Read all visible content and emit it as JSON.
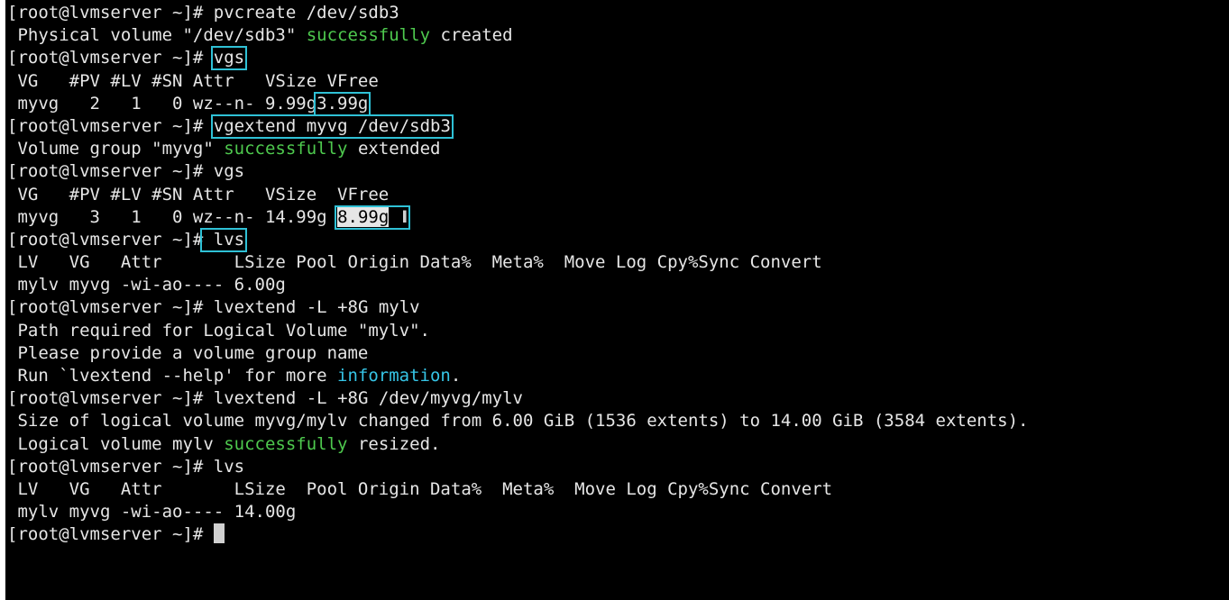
{
  "terminal": {
    "prompt": "[root@lvmserver ~]#",
    "lines": {
      "l0_cmd": "pvcreate /dev/sdb3",
      "l1_a": " Physical volume \"/dev/sdb3\" ",
      "l1_ok": "successfully",
      "l1_b": " created",
      "l2_cmd": "vgs",
      "l3": " VG   #PV #LV #SN Attr   VSize VFree",
      "l4_a": " myvg   2   1   0 wz--n- 9.99g",
      "l4_hl": "3.99g",
      "l5_cmd": "vgextend myvg /dev/sdb3",
      "l6_a": " Volume group \"myvg\" ",
      "l6_ok": "successfully",
      "l6_b": " extended",
      "l7_cmd": "vgs",
      "l8": " VG   #PV #LV #SN Attr   VSize  VFree",
      "l9_a": " myvg   3   1   0 wz--n- 14.99g",
      "l9_hl": "8.99g",
      "l10_cmd": "lvs",
      "l11": " LV   VG   Attr       LSize Pool Origin Data%  Meta%  Move Log Cpy%Sync Convert",
      "l12": " mylv myvg -wi-ao---- 6.00g",
      "l13_cmd": "lvextend -L +8G mylv",
      "l14": " Path required for Logical Volume \"mylv\".",
      "l15": " Please provide a volume group name",
      "l16_a": " Run `lvextend --help' for more ",
      "l16_info": "information",
      "l16_b": ".",
      "l17_cmd": "lvextend -L +8G /dev/myvg/mylv",
      "l18": " Size of logical volume myvg/mylv changed from 6.00 GiB (1536 extents) to 14.00 GiB (3584 extents).",
      "l19_a": " Logical volume mylv ",
      "l19_ok": "successfully",
      "l19_b": " resized.",
      "l20_cmd": "lvs",
      "l21": " LV   VG   Attr       LSize  Pool Origin Data%  Meta%  Move Log Cpy%Sync Convert",
      "l22": " mylv myvg -wi-ao---- 14.00g"
    },
    "colors": {
      "background": "#000000",
      "text": "#e6e6e6",
      "success": "#4ec94e",
      "info": "#36c5e6",
      "highlight_box": "#2fc1d6"
    },
    "icons": {
      "text_cursor": "i-beam-cursor-icon",
      "block_cursor": "block-cursor"
    }
  }
}
